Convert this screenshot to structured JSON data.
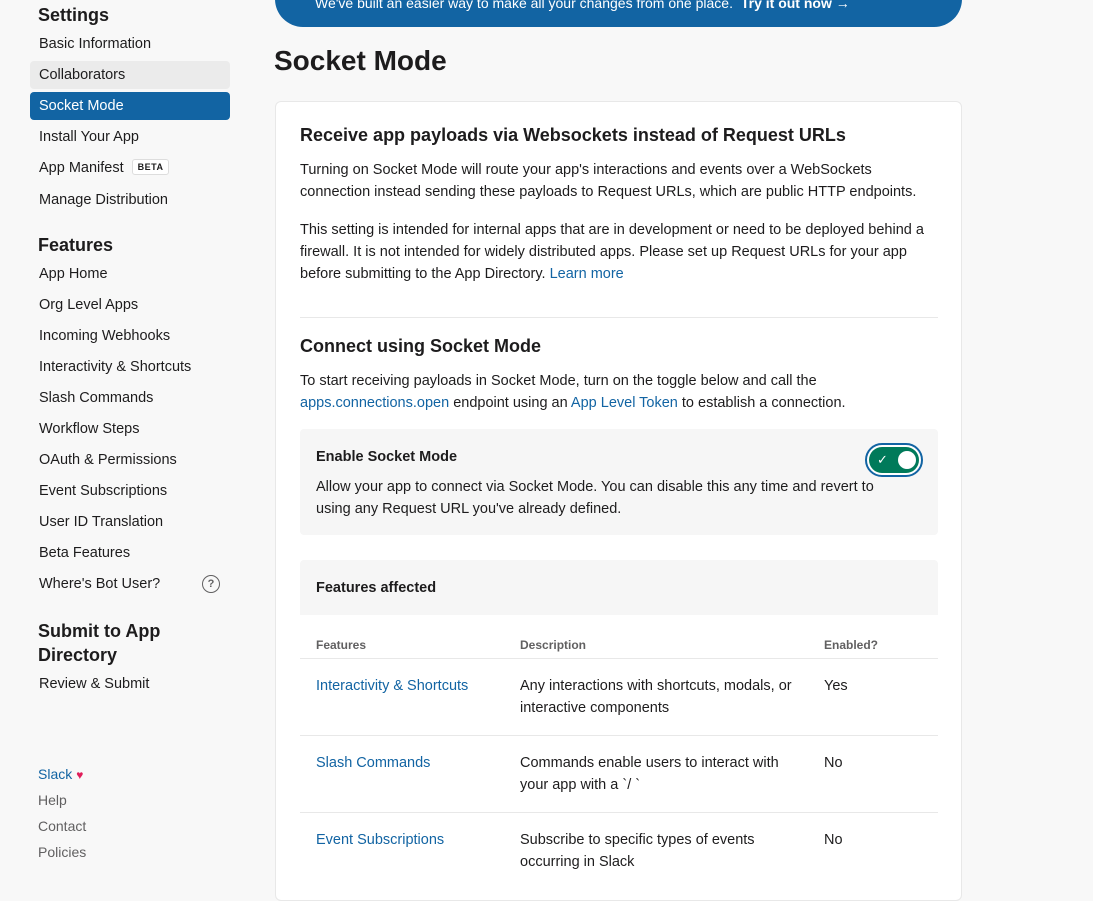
{
  "sidebar": {
    "settings_title": "Settings",
    "settings_items": [
      {
        "label": "Basic Information"
      },
      {
        "label": "Collaborators"
      },
      {
        "label": "Socket Mode"
      },
      {
        "label": "Install Your App"
      },
      {
        "label": "App Manifest",
        "badge": "BETA"
      },
      {
        "label": "Manage Distribution"
      }
    ],
    "features_title": "Features",
    "features_items": [
      {
        "label": "App Home"
      },
      {
        "label": "Org Level Apps"
      },
      {
        "label": "Incoming Webhooks"
      },
      {
        "label": "Interactivity & Shortcuts"
      },
      {
        "label": "Slash Commands"
      },
      {
        "label": "Workflow Steps"
      },
      {
        "label": "OAuth & Permissions"
      },
      {
        "label": "Event Subscriptions"
      },
      {
        "label": "User ID Translation"
      },
      {
        "label": "Beta Features"
      },
      {
        "label": "Where's Bot User?",
        "help_icon": "?"
      }
    ],
    "submit_title": "Submit to App Directory",
    "submit_items": [
      {
        "label": "Review & Submit"
      }
    ],
    "footer": {
      "slack": "Slack",
      "heart": "♥",
      "help": "Help",
      "contact": "Contact",
      "policies": "Policies"
    }
  },
  "banner": {
    "text": "We've built an easier way to make all your changes from one place.",
    "cta": "Try it out now",
    "arrow": "→"
  },
  "page": {
    "title": "Socket Mode"
  },
  "section1": {
    "heading": "Receive app payloads via Websockets instead of Request URLs",
    "para1": "Turning on Socket Mode will route your app's interactions and events over a WebSockets connection instead sending these payloads to Request URLs, which are public HTTP endpoints.",
    "para2": "This setting is intended for internal apps that are in development or need to be deployed behind a firewall. It is not intended for widely distributed apps. Please set up Request URLs for your app before submitting to the App Directory.",
    "learn_more": "Learn more"
  },
  "section2": {
    "heading": "Connect using Socket Mode",
    "intro_part1": "To start receiving payloads in Socket Mode, turn on the toggle below and call the",
    "link_connections": "apps.connections.open",
    "intro_part2": "endpoint using an",
    "link_token": "App Level Token",
    "intro_part3": "to establish a connection."
  },
  "toggle": {
    "title": "Enable Socket Mode",
    "description": "Allow your app to connect via Socket Mode. You can disable this any time and revert to using any Request URL you've already defined.",
    "enabled": true,
    "check": "✓"
  },
  "features_table": {
    "title": "Features affected",
    "columns": [
      "Features",
      "Description",
      "Enabled?"
    ],
    "rows": [
      {
        "feature": "Interactivity & Shortcuts",
        "description": "Any interactions with shortcuts, modals, or interactive components",
        "enabled": "Yes"
      },
      {
        "feature": "Slash Commands",
        "description": "Commands enable users to interact with your app with a `/ `",
        "enabled": "No"
      },
      {
        "feature": "Event Subscriptions",
        "description": "Subscribe to specific types of events occurring in Slack",
        "enabled": "No"
      }
    ]
  },
  "colors": {
    "accent": "#1264a3",
    "toggle_on": "#007a5a",
    "heart": "#e01e5a"
  }
}
